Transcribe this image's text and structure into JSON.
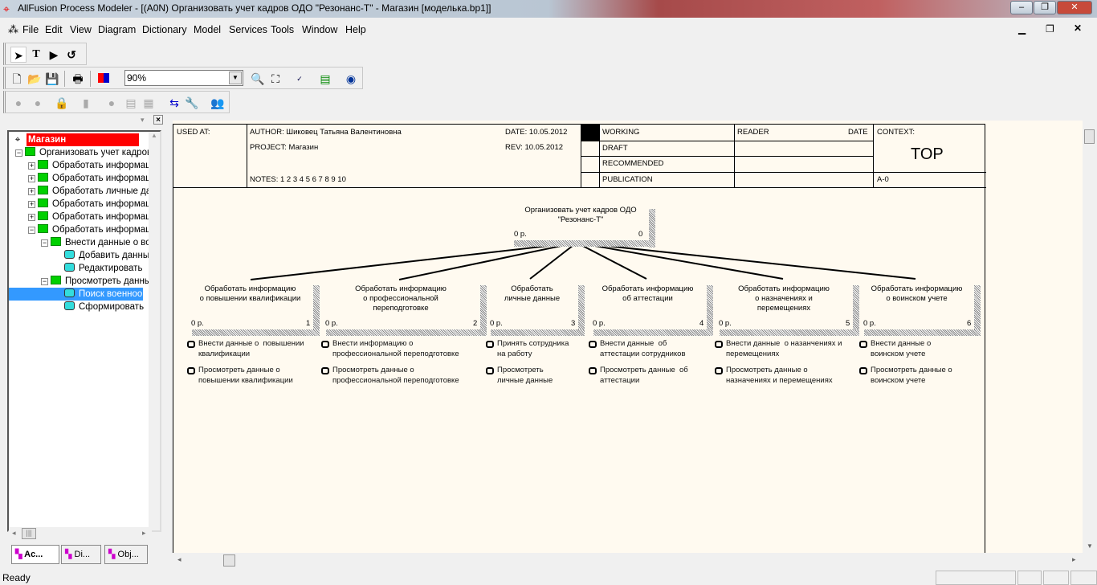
{
  "window": {
    "title": "AllFusion Process Modeler - [(A0N) Организовать учет кадров ОДО  \"Резонанс-Т\" - Магазин  [моделька.bp1]]",
    "minimize": "‒",
    "restore": "❐",
    "close": "✕"
  },
  "menu": [
    "File",
    "Edit",
    "View",
    "Diagram",
    "Dictionary",
    "Model",
    "Services",
    "Tools",
    "Window",
    "Help"
  ],
  "toolbar": {
    "zoom": "90%"
  },
  "tree": {
    "root": "Магазин",
    "items": [
      {
        "label": "Организовать учет кадров ОДО",
        "level": 0,
        "exp": "−",
        "icon": "box"
      },
      {
        "label": "Обработать информацию",
        "level": 1,
        "exp": "+",
        "icon": "box"
      },
      {
        "label": "Обработать информацию",
        "level": 1,
        "exp": "+",
        "icon": "box"
      },
      {
        "label": "Обработать  личные данные",
        "level": 1,
        "exp": "+",
        "icon": "box"
      },
      {
        "label": "Обработать информацию",
        "level": 1,
        "exp": "+",
        "icon": "box"
      },
      {
        "label": "Обработать информацию",
        "level": 1,
        "exp": "+",
        "icon": "box"
      },
      {
        "label": "Обработать информацию",
        "level": 1,
        "exp": "−",
        "icon": "box"
      },
      {
        "label": "Внести данные о воинском",
        "level": 2,
        "exp": "−",
        "icon": "box"
      },
      {
        "label": "Добавить данные",
        "level": 3,
        "exp": "",
        "icon": "cy"
      },
      {
        "label": "Редактировать",
        "level": 3,
        "exp": "",
        "icon": "cy"
      },
      {
        "label": "Просмотреть данные",
        "level": 2,
        "exp": "−",
        "icon": "box"
      },
      {
        "label": "Поиск военнообязанных",
        "level": 3,
        "exp": "",
        "icon": "cy",
        "selected": true
      },
      {
        "label": "Сформировать",
        "level": 3,
        "exp": "",
        "icon": "cy"
      }
    ]
  },
  "tabs": [
    "Ac...",
    "Di...",
    "Obj..."
  ],
  "header": {
    "used_at": "USED AT:",
    "author": "AUTHOR:  Шиковец Татьяна Валентиновна",
    "project": "PROJECT:  Магазин",
    "date": "DATE:  10.05.2012",
    "rev": "REV:    10.05.2012",
    "notes": "NOTES:  1  2  3  4  5  6  7  8  9  10",
    "working": "WORKING",
    "draft": "DRAFT",
    "recommended": "RECOMMENDED",
    "publication": "PUBLICATION",
    "reader": "READER",
    "date2": "DATE",
    "context": "CONTEXT:",
    "top": "TOP",
    "node": "A-0"
  },
  "diagram": {
    "parent": {
      "title": "Организовать учет кадров ОДО\n\"Резонанс-Т\"",
      "cost": "0 р.",
      "num": "0"
    },
    "children": [
      {
        "title": "Обработать информацию\nо повышении квалификации",
        "cost": "0 р.",
        "num": "1",
        "bullets": [
          "Внести данные о  повышении\nквалификации",
          "Просмотреть данные о\nповышении квалификации"
        ]
      },
      {
        "title": "Обработать информацию\nо профессиональной\nпереподготовке",
        "cost": "0 р.",
        "num": "2",
        "bullets": [
          "Внести информацию о\nпрофессиональной переподготовке",
          "Просмотреть данные о\nпрофессиональной переподготовке"
        ]
      },
      {
        "title": "Обработать\nличные данные",
        "cost": "0 р.",
        "num": "3",
        "bullets": [
          "Принять сотрудника\nна работу",
          "Просмотреть\nличные данные"
        ]
      },
      {
        "title": "Обработать информацию\nоб аттестации",
        "cost": "0 р.",
        "num": "4",
        "bullets": [
          "Внести данные  об\nаттестации сотрудников",
          "Просмотреть данные  об\nаттестации"
        ]
      },
      {
        "title": "Обработать информацию\nо назначениях и\nперемещениях",
        "cost": "0 р.",
        "num": "5",
        "bullets": [
          "Внести данные  о назанчениях и\nперемещениях",
          "Просмотреть данные о\nназначениях и перемещениях"
        ]
      },
      {
        "title": "Обработать информацию\nо воинском учете",
        "cost": "0 р.",
        "num": "6",
        "bullets": [
          "Внести данные о\nвоинском учете",
          "Просмотреть данные о\nвоинском учете"
        ]
      }
    ]
  },
  "status": {
    "text": "Ready"
  }
}
